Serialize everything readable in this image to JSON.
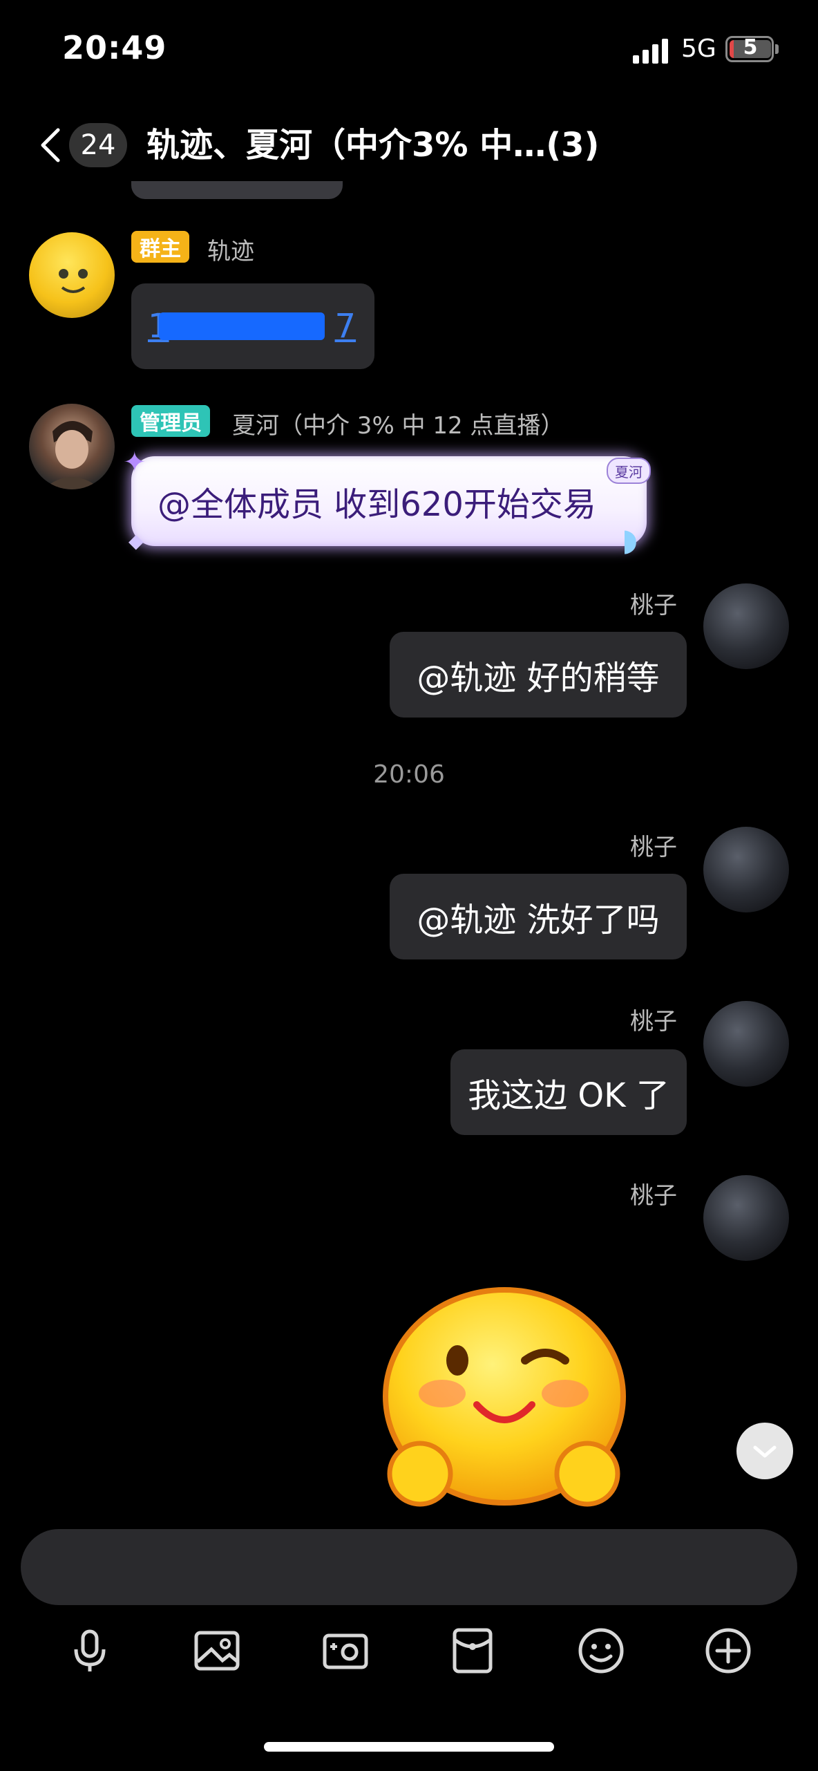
{
  "status_bar": {
    "time": "20:49",
    "network": "5G",
    "battery": "5"
  },
  "header": {
    "unread_count": "24",
    "title": "轨迹、夏河（中介3% 中…(3)"
  },
  "messages": [
    {
      "badge": "群主",
      "sender": "轨迹",
      "text": "1",
      "text_tail": "7"
    },
    {
      "badge": "管理员",
      "sender": "夏河（中介 3% 中 12 点直播）",
      "text": "@全体成员 收到620开始交易",
      "bubble_tag": "夏河"
    },
    {
      "sender": "桃子",
      "text": "@轨迹 好的稍等"
    },
    {
      "timestamp": "20:06"
    },
    {
      "sender": "桃子",
      "text": "@轨迹 洗好了吗"
    },
    {
      "sender": "桃子",
      "text": "我这边 OK 了"
    },
    {
      "sender": "桃子",
      "sticker": "wink-smile-sticker"
    }
  ],
  "icons": {
    "back": "chevron-left-icon",
    "scroll_down": "chevron-down-icon",
    "toolbar": [
      "microphone-icon",
      "image-icon",
      "camera-icon",
      "red-packet-icon",
      "emoji-icon",
      "plus-icon"
    ]
  },
  "colors": {
    "link": "#3d7ff0",
    "owner_badge": "#f5b318",
    "admin_badge": "#2ec4b6",
    "bubble": "#2b2b2e"
  }
}
